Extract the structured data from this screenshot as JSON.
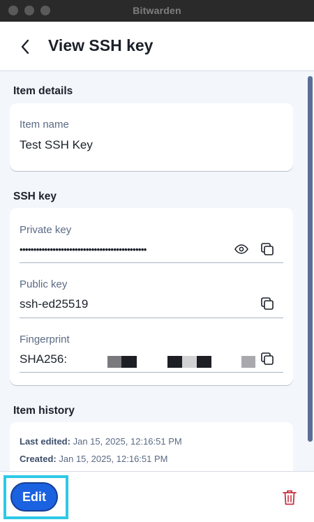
{
  "window": {
    "title": "Bitwarden"
  },
  "header": {
    "title": "View SSH key"
  },
  "item_details": {
    "section_title": "Item details",
    "item_name_label": "Item name",
    "item_name_value": "Test SSH Key"
  },
  "ssh_key": {
    "section_title": "SSH key",
    "private_key_label": "Private key",
    "private_key_masked": "••••••••••••••••••••••••••••••••••••••••••••••",
    "public_key_label": "Public key",
    "public_key_value": "ssh-ed25519",
    "fingerprint_label": "Fingerprint",
    "fingerprint_value": "SHA256:"
  },
  "item_history": {
    "section_title": "Item history",
    "last_edited_label": "Last edited:",
    "last_edited_value": "Jan 15, 2025, 12:16:51 PM",
    "created_label": "Created:",
    "created_value": "Jan 15, 2025, 12:16:51 PM"
  },
  "footer": {
    "edit_label": "Edit"
  },
  "colors": {
    "accent": "#1b62e0",
    "highlight": "#2ec9e6",
    "danger": "#c8313f"
  },
  "icons": [
    "back-icon",
    "eye-icon",
    "copy-icon",
    "trash-icon"
  ]
}
